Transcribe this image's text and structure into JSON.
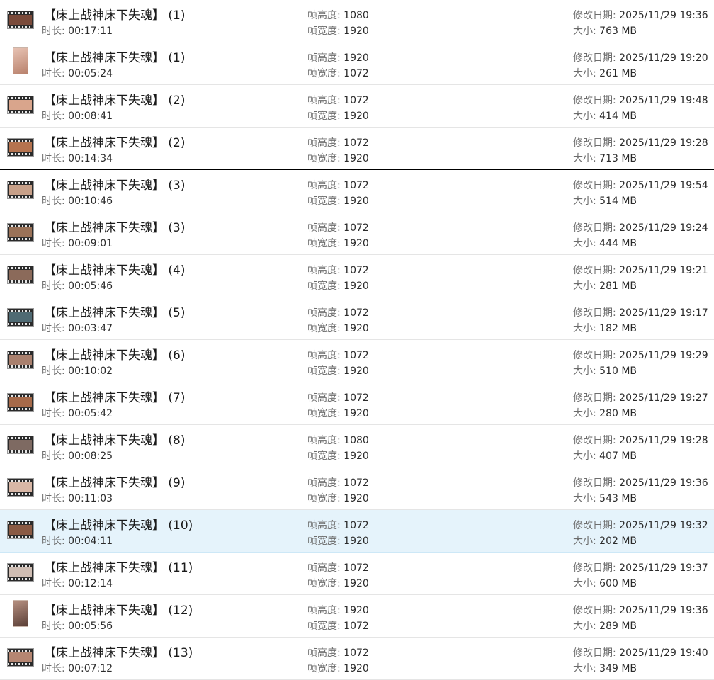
{
  "labels": {
    "duration": "时长: ",
    "frame_height": "帧高度: ",
    "frame_width": "帧宽度: ",
    "modified": "修改日期: ",
    "size": "大小: "
  },
  "files": [
    {
      "title": "【床上战神床下失魂】 (1)",
      "duration": "00:17:11",
      "frame_height": "1080",
      "frame_width": "1920",
      "modified": "2025/11/29 19:36",
      "size": "763 MB",
      "thumb_color": "#7a4a3a",
      "thumb": "video-thumbnail-icon"
    },
    {
      "title": "【床上战神床下失魂】 (1)",
      "duration": "00:05:24",
      "frame_height": "1920",
      "frame_width": "1072",
      "modified": "2025/11/29 19:20",
      "size": "261 MB",
      "thumb_color": "#c98f7c",
      "thumb": "video-thumbnail-icon"
    },
    {
      "title": "【床上战神床下失魂】 (2)",
      "duration": "00:08:41",
      "frame_height": "1072",
      "frame_width": "1920",
      "modified": "2025/11/29 19:48",
      "size": "414 MB",
      "thumb_color": "#d9a58c",
      "thumb": "video-thumbnail-icon"
    },
    {
      "title": "【床上战神床下失魂】 (2)",
      "duration": "00:14:34",
      "frame_height": "1072",
      "frame_width": "1920",
      "modified": "2025/11/29 19:28",
      "size": "713 MB",
      "thumb_color": "#b5734f",
      "thumb": "video-thumbnail-icon"
    },
    {
      "title": "【床上战神床下失魂】 (3)",
      "duration": "00:10:46",
      "frame_height": "1072",
      "frame_width": "1920",
      "modified": "2025/11/29 19:54",
      "size": "514 MB",
      "thumb_color": "#c7a089",
      "thumb": "video-thumbnail-icon"
    },
    {
      "title": "【床上战神床下失魂】 (3)",
      "duration": "00:09:01",
      "frame_height": "1072",
      "frame_width": "1920",
      "modified": "2025/11/29 19:24",
      "size": "444 MB",
      "thumb_color": "#9a7258",
      "thumb": "video-thumbnail-icon"
    },
    {
      "title": "【床上战神床下失魂】 (4)",
      "duration": "00:05:46",
      "frame_height": "1072",
      "frame_width": "1920",
      "modified": "2025/11/29 19:21",
      "size": "281 MB",
      "thumb_color": "#8b6a5a",
      "thumb": "video-thumbnail-icon"
    },
    {
      "title": "【床上战神床下失魂】 (5)",
      "duration": "00:03:47",
      "frame_height": "1072",
      "frame_width": "1920",
      "modified": "2025/11/29 19:17",
      "size": "182 MB",
      "thumb_color": "#4f6a73",
      "thumb": "video-thumbnail-icon"
    },
    {
      "title": "【床上战神床下失魂】 (6)",
      "duration": "00:10:02",
      "frame_height": "1072",
      "frame_width": "1920",
      "modified": "2025/11/29 19:29",
      "size": "510 MB",
      "thumb_color": "#a9806e",
      "thumb": "video-thumbnail-icon"
    },
    {
      "title": "【床上战神床下失魂】 (7)",
      "duration": "00:05:42",
      "frame_height": "1072",
      "frame_width": "1920",
      "modified": "2025/11/29 19:27",
      "size": "280 MB",
      "thumb_color": "#a66a4a",
      "thumb": "video-thumbnail-icon"
    },
    {
      "title": "【床上战神床下失魂】 (8)",
      "duration": "00:08:25",
      "frame_height": "1080",
      "frame_width": "1920",
      "modified": "2025/11/29 19:28",
      "size": "407 MB",
      "thumb_color": "#7e6a62",
      "thumb": "video-thumbnail-icon"
    },
    {
      "title": "【床上战神床下失魂】 (9)",
      "duration": "00:11:03",
      "frame_height": "1072",
      "frame_width": "1920",
      "modified": "2025/11/29 19:36",
      "size": "543 MB",
      "thumb_color": "#d8b7a6",
      "thumb": "video-thumbnail-icon"
    },
    {
      "title": "【床上战神床下失魂】 (10)",
      "duration": "00:04:11",
      "frame_height": "1072",
      "frame_width": "1920",
      "modified": "2025/11/29 19:32",
      "size": "202 MB",
      "thumb_color": "#8a5a44",
      "thumb": "video-thumbnail-icon"
    },
    {
      "title": "【床上战神床下失魂】 (11)",
      "duration": "00:12:14",
      "frame_height": "1072",
      "frame_width": "1920",
      "modified": "2025/11/29 19:37",
      "size": "600 MB",
      "thumb_color": "#cfbdb3",
      "thumb": "video-thumbnail-icon"
    },
    {
      "title": "【床上战神床下失魂】 (12)",
      "duration": "00:05:56",
      "frame_height": "1920",
      "frame_width": "1072",
      "modified": "2025/11/29 19:36",
      "size": "289 MB",
      "thumb_color": "#8c6c60",
      "thumb": "video-thumbnail-icon"
    },
    {
      "title": "【床上战神床下失魂】 (13)",
      "duration": "00:07:12",
      "frame_height": "1072",
      "frame_width": "1920",
      "modified": "2025/11/29 19:40",
      "size": "349 MB",
      "thumb_color": "#b58672",
      "thumb": "video-thumbnail-icon"
    }
  ]
}
